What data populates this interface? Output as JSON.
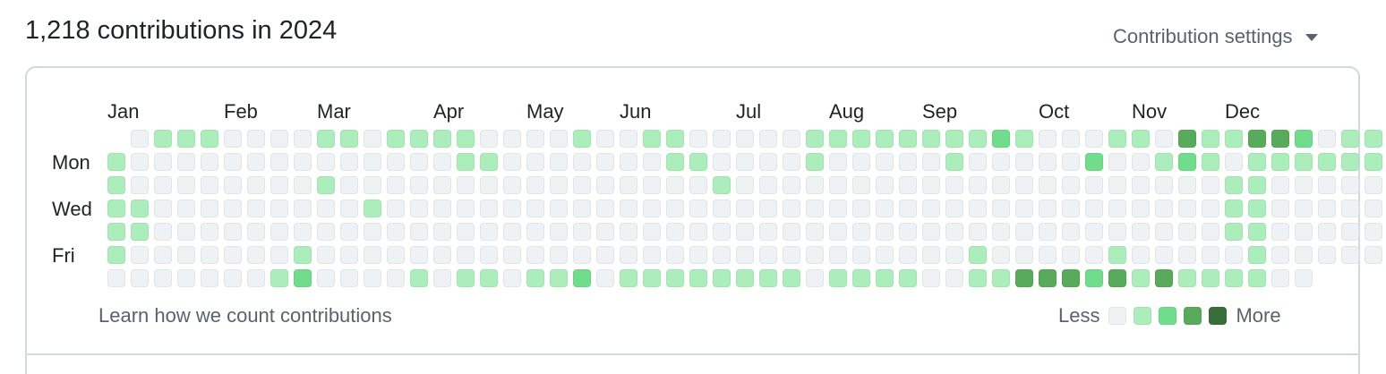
{
  "header": {
    "title": "1,218 contributions in 2024",
    "settings_label": "Contribution settings",
    "settings_icon": "triangle-down-icon"
  },
  "calendar": {
    "year": 2024,
    "months": [
      {
        "label": "Jan",
        "week": 0
      },
      {
        "label": "Feb",
        "week": 5
      },
      {
        "label": "Mar",
        "week": 9
      },
      {
        "label": "Apr",
        "week": 14
      },
      {
        "label": "May",
        "week": 18
      },
      {
        "label": "Jun",
        "week": 22
      },
      {
        "label": "Jul",
        "week": 27
      },
      {
        "label": "Aug",
        "week": 31
      },
      {
        "label": "Sep",
        "week": 35
      },
      {
        "label": "Oct",
        "week": 40
      },
      {
        "label": "Nov",
        "week": 44
      },
      {
        "label": "Dec",
        "week": 48
      }
    ],
    "day_labels": [
      {
        "label": "Mon",
        "row": 1
      },
      {
        "label": "Wed",
        "row": 3
      },
      {
        "label": "Fri",
        "row": 5
      }
    ],
    "rows": [
      "-01110000110111100001001100000111111112100011031133201100",
      "1000000000000001100000001100001000001000002001210111111000",
      "100000000100000000000000001000000000000000000000110000000",
      "110000000001000000000000000000000000000000000000110000000",
      "110000000000000000000000000000000000000000000000110000000",
      "10000000100000000000000000000000000001000001000001000000",
      "0000000120000101101120111111110111100113332313111100"
    ]
  },
  "levels": {
    "colors": [
      "#eff2f5",
      "#aceebb",
      "#6fdd8b",
      "#57ab5a",
      "#376f3b"
    ],
    "overrides": {
      "0": "#eff2f5",
      "1": "#aceebb",
      "2": "#6fdd8b",
      "3": "#57ab5a",
      "4": "#3a6f41"
    }
  },
  "footer": {
    "learn_link": "Learn how we count contributions",
    "legend_less": "Less",
    "legend_more": "More"
  }
}
